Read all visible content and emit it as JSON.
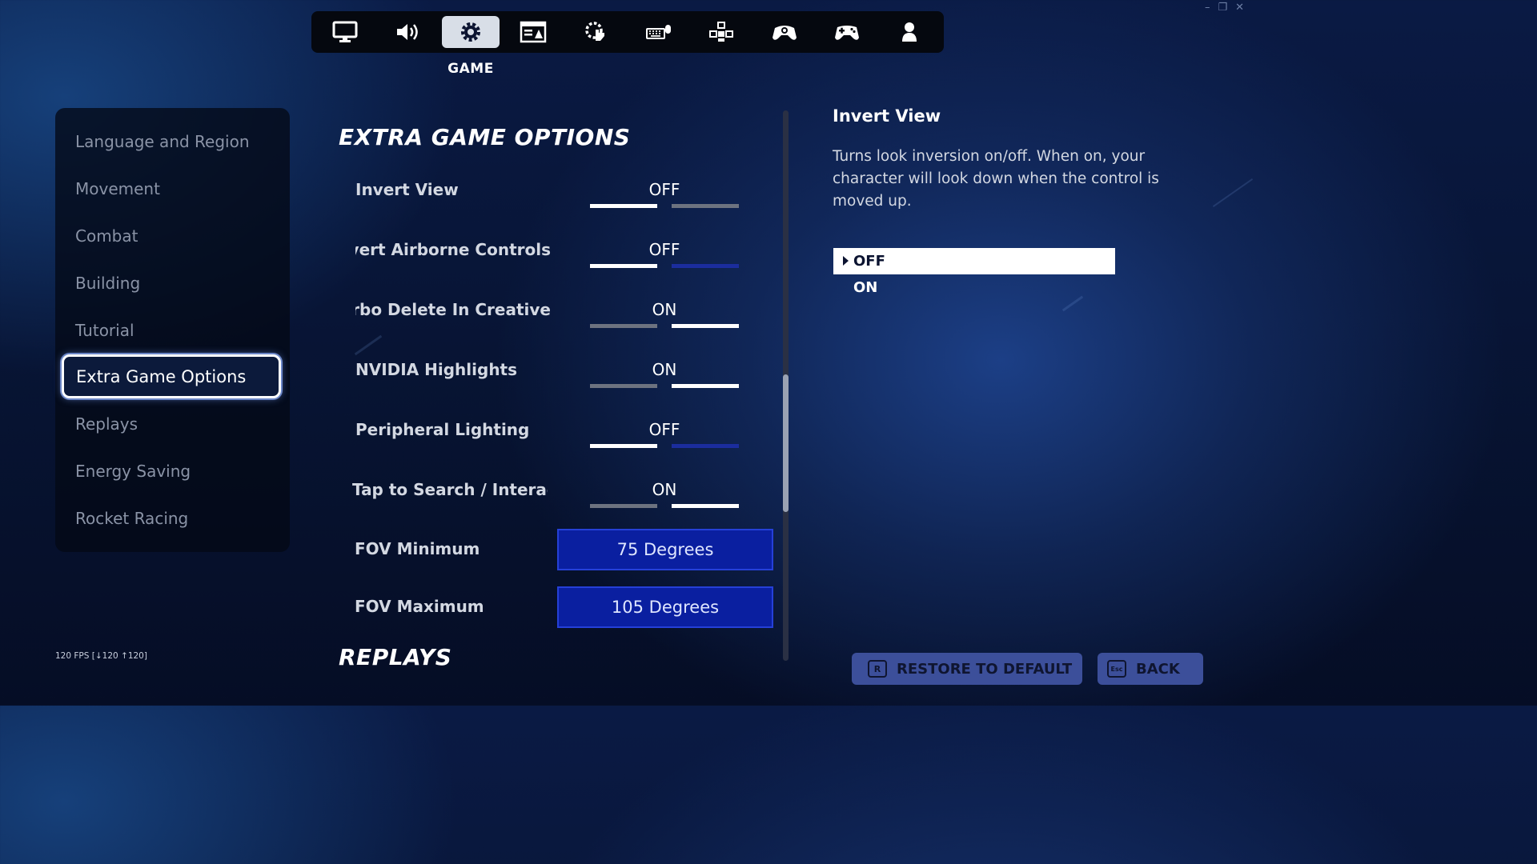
{
  "window_controls": {
    "minimize": "–",
    "restore": "❐",
    "close": "✕"
  },
  "tabs": [
    {
      "icon": "monitor-icon"
    },
    {
      "icon": "speaker-icon"
    },
    {
      "icon": "gear-icon",
      "active": true
    },
    {
      "icon": "display-text-icon"
    },
    {
      "icon": "touch-settings-icon"
    },
    {
      "icon": "keyboard-mouse-icon"
    },
    {
      "icon": "controller-buttons-icon"
    },
    {
      "icon": "controller-settings-icon"
    },
    {
      "icon": "gamepad-icon"
    },
    {
      "icon": "account-icon"
    }
  ],
  "active_tab_label": "GAME",
  "sidebar": {
    "items": [
      {
        "label": "Language and Region"
      },
      {
        "label": "Movement"
      },
      {
        "label": "Combat"
      },
      {
        "label": "Building"
      },
      {
        "label": "Tutorial"
      },
      {
        "label": "Extra Game Options",
        "selected": true
      },
      {
        "label": "Replays"
      },
      {
        "label": "Energy Saving"
      },
      {
        "label": "Rocket Racing"
      }
    ]
  },
  "fps_counter": "120 FPS [↓120 ↑120]",
  "main": {
    "section_title": "EXTRA GAME OPTIONS",
    "next_section_title": "REPLAYS",
    "settings": [
      {
        "label": "Invert View",
        "value": "OFF"
      },
      {
        "label": "Invert Airborne Controls",
        "value": "OFF"
      },
      {
        "label": "Turbo Delete In Creative",
        "value": "ON"
      },
      {
        "label": "NVIDIA Highlights",
        "value": "ON"
      },
      {
        "label": "Peripheral Lighting",
        "value": "OFF"
      },
      {
        "label": "Tap to Search / Interact",
        "value": "ON"
      }
    ],
    "fov_min": {
      "label": "FOV Minimum",
      "value": "75 Degrees"
    },
    "fov_max": {
      "label": "FOV Maximum",
      "value": "105 Degrees"
    }
  },
  "detail": {
    "title": "Invert View",
    "description": "Turns look inversion on/off.  When on, your character will look down when the control is moved up.",
    "options": [
      "OFF",
      "ON"
    ],
    "selected_option": "OFF"
  },
  "footer": {
    "restore_key": "R",
    "restore_label": "RESTORE TO DEFAULT",
    "back_key": "Esc",
    "back_label": "BACK"
  },
  "colors": {
    "accent_blue": "#0a1fa0",
    "toggle_on": "#ffffff",
    "toggle_off_gray": "#6d7380",
    "toggle_off_blue": "#1b2d9e",
    "button_bg": "#3c4f9a"
  }
}
